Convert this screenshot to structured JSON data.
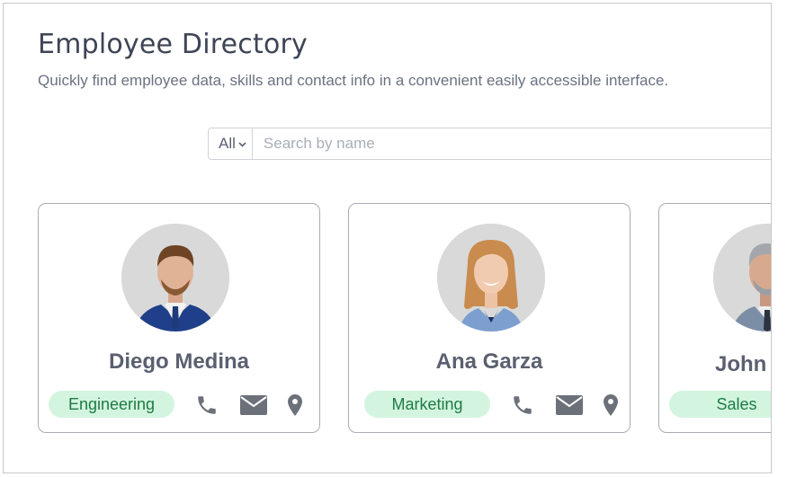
{
  "header": {
    "title": "Employee Directory",
    "subtitle": "Quickly find employee data, skills and contact info in a convenient easily accessible interface."
  },
  "search": {
    "filter_value": "All",
    "placeholder": "Search by name"
  },
  "employees": [
    {
      "name": "Diego Medina",
      "department": "Engineering"
    },
    {
      "name": "Ana Garza",
      "department": "Marketing"
    },
    {
      "name": "John",
      "department": "Sales"
    }
  ],
  "icons": [
    "phone-icon",
    "mail-icon",
    "location-icon"
  ],
  "colors": {
    "title": "#3d4455",
    "badge_bg": "#d3f5df",
    "badge_text": "#1f7a45",
    "icon": "#6b7079"
  }
}
